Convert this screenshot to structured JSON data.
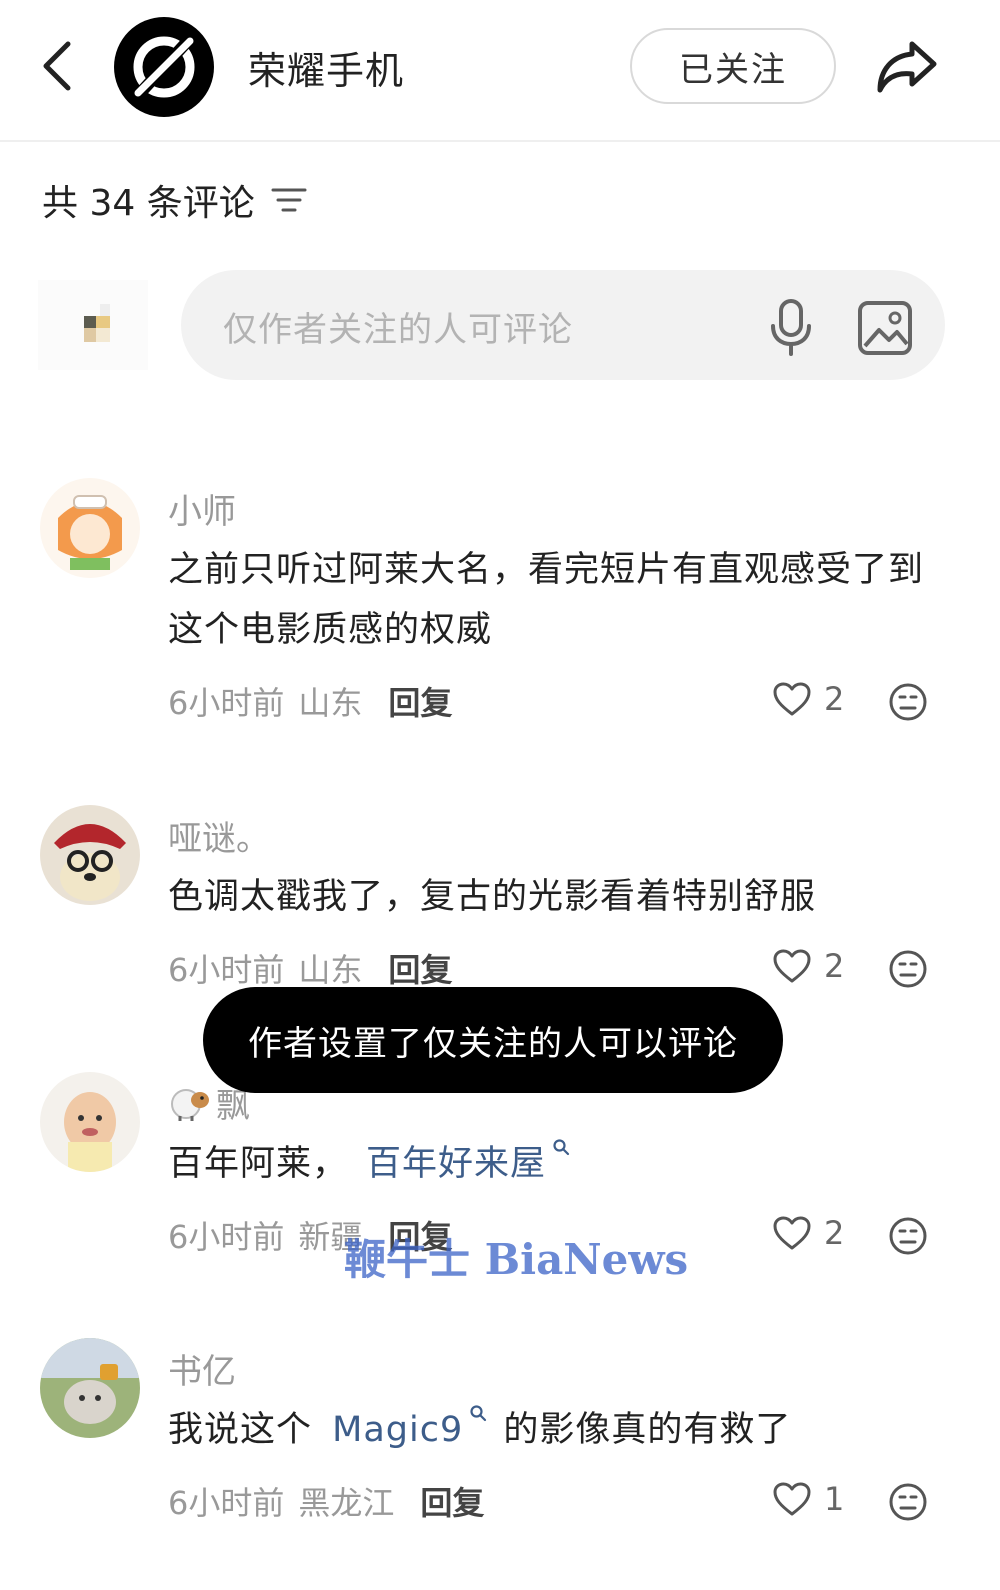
{
  "header": {
    "title": "荣耀手机",
    "follow_label": "已关注"
  },
  "comments_header": {
    "count_text": "共 34 条评论"
  },
  "input": {
    "placeholder": "仅作者关注的人可评论"
  },
  "comments": [
    {
      "name": "小师",
      "text": "之前只听过阿莱大名，看完短片有直观感受了到这个电影质感的权威",
      "time": "6小时前",
      "location": "山东",
      "reply_label": "回复",
      "likes": "2"
    },
    {
      "name": "哑谜。",
      "text": "色调太戳我了，复古的光影看着特别舒服",
      "time": "6小时前",
      "location": "山东",
      "reply_label": "回复",
      "likes": "2"
    },
    {
      "name": "飘",
      "text_prefix": "百年阿莱，",
      "text_link": "百年好来屋",
      "time": "6小时前",
      "location": "新疆",
      "reply_label": "回复",
      "likes": "2"
    },
    {
      "name": "书亿",
      "text_prefix": "我说这个 ",
      "text_link": "Magic9",
      "text_suffix": " 的影像真的有救了",
      "time": "6小时前",
      "location": "黑龙江",
      "reply_label": "回复",
      "likes": "1"
    }
  ],
  "toast": "作者设置了仅关注的人可以评论",
  "watermark": "鞭牛士 BiaNews",
  "icons": [
    "back-arrow-icon",
    "brand-logo-icon",
    "share-icon",
    "sort-icon",
    "mic-icon",
    "image-icon",
    "heart-icon",
    "emoji-icon",
    "search-icon"
  ]
}
